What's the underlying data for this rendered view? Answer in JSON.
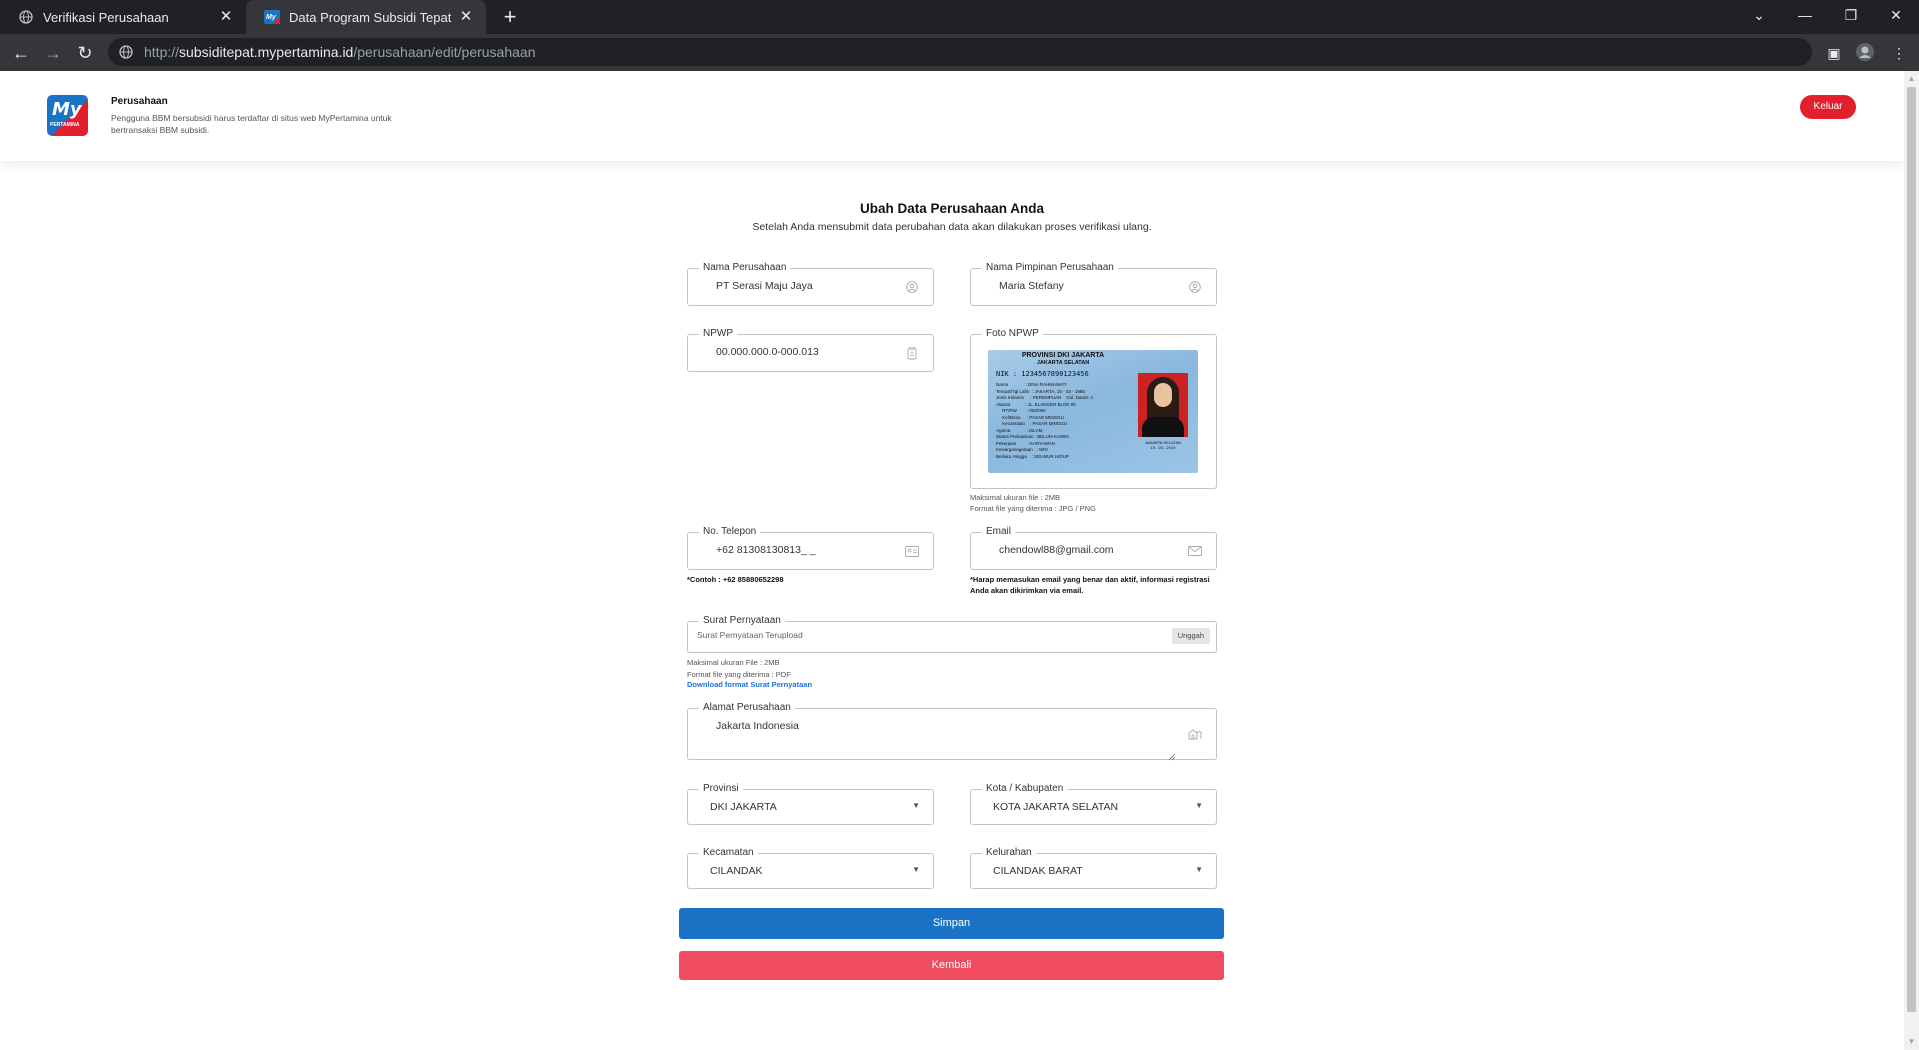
{
  "browser": {
    "tabs": [
      {
        "title": "Verifikasi Perusahaan",
        "active": false
      },
      {
        "title": "Data Program Subsidi Tepat",
        "active": true
      }
    ],
    "url_prefix": "http://",
    "url_domain": "subsiditepat.mypertamina.id",
    "url_path": "/perusahaan/edit/perusahaan"
  },
  "header": {
    "logo_text": "My",
    "logo_sub": "PERTAMINA",
    "title": "Perusahaan",
    "description": "Pengguna BBM bersubsidi harus terdaftar di situs web MyPertamina untuk bertransaksi BBM subsidi.",
    "logout_label": "Keluar"
  },
  "form": {
    "title": "Ubah Data Perusahaan Anda",
    "subtitle": "Setelah Anda mensubmit data perubahan data akan dilakukan proses verifikasi ulang.",
    "company_name": {
      "label": "Nama Perusahaan",
      "value": "PT Serasi Maju Jaya"
    },
    "leader_name": {
      "label": "Nama Pimpinan Perusahaan",
      "value": "Maria Stefany"
    },
    "npwp": {
      "label": "NPWP",
      "value": "00.000.000.0-000.013"
    },
    "npwp_photo": {
      "label": "Foto NPWP",
      "hint_size": "Maksimal ukuran file : 2MB",
      "hint_format": "Format file yang diterima : JPG / PNG",
      "card": {
        "province": "PROVINSI DKI JAKARTA",
        "city": "JAKARTA SELATAN",
        "nik": "NIK      : 1234567890123456",
        "rows": "Nama              : DINA RAHMAWATI\nTempat/Tgl Lahir  : JAKARTA, 15 - 03 - 1985\nJenis Kelamin     : PEREMPUAN    Gol. Darah: A\nAlamat            : JL. ELANGER BLOK 00\n     RT/RW        : 000/000\n     Kel/Desa     : PASAR MINGGU\n     Kecamatan    : PASAR MINGGU\nAgama             : ISLAM\nStatus Perkawinan : BELUM KAWIN\nPekerjaan         : KARYAWAN\nKewarganegaraan   : WNI\nBerlaku Hingga    : SEUMUR HIDUP",
        "signature": "JAKARTA SELATAN\n15 - 03 - 2019"
      }
    },
    "phone": {
      "label": "No. Telepon",
      "value": "+62 81308130813_ _",
      "hint": "*Contoh : +62 85880652298"
    },
    "email": {
      "label": "Email",
      "value": "chendowl88@gmail.com",
      "hint": "*Harap memasukan email yang benar dan aktif, informasi registrasi Anda akan dikirimkan via email."
    },
    "statement": {
      "label": "Surat Pernyataan",
      "value": "Surat Pernyataan Terupload",
      "upload_label": "Unggah",
      "hint_size": "Maksimal ukuran File : 2MB",
      "hint_format": "Format file yang diterima : PDF",
      "download_link": "Download format Surat Pernyataan"
    },
    "address": {
      "label": "Alamat Perusahaan",
      "value": "Jakarta Indonesia"
    },
    "province": {
      "label": "Provinsi",
      "value": "DKI JAKARTA"
    },
    "city": {
      "label": "Kota / Kabupaten",
      "value": "KOTA JAKARTA SELATAN"
    },
    "district": {
      "label": "Kecamatan",
      "value": "CILANDAK"
    },
    "village": {
      "label": "Kelurahan",
      "value": "CILANDAK BARAT"
    },
    "save_label": "Simpan",
    "back_label": "Kembali"
  },
  "colors": {
    "primary": "#1a73c5",
    "danger": "#e31f2e",
    "back_button": "#f04b5f"
  },
  "icons": [
    "globe-icon",
    "mypertamina-favicon",
    "close-icon",
    "plus-icon",
    "back-arrow-icon",
    "forward-arrow-icon",
    "reload-icon",
    "site-info-icon",
    "side-panel-icon",
    "profile-avatar-icon",
    "menu-kebab-icon",
    "user-icon",
    "clipboard-icon",
    "contact-card-icon",
    "envelope-icon",
    "building-icon",
    "caret-down-icon"
  ]
}
